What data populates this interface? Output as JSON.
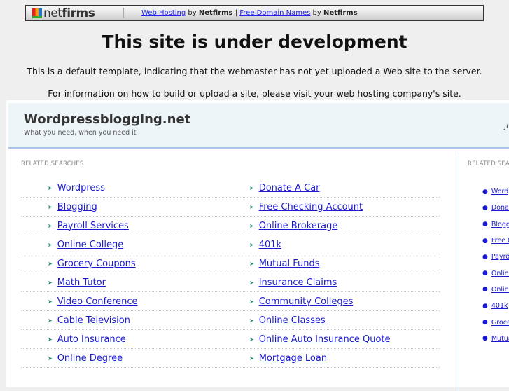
{
  "topbar": {
    "logo": "netfirms",
    "link1": "Web Hosting",
    "by1": "by",
    "brand1": "Netfirms",
    "sep": "|",
    "link2": "Free Domain Names",
    "by2": "by",
    "brand2": "Netfirms"
  },
  "title": "This site is under development",
  "message1": "This is a default template, indicating that the webmaster has not yet uploaded a Web site to the server.",
  "message2": "For information on how to build or upload a site, please visit your web hosting company's site.",
  "site": {
    "name": "Wordpressblogging.net",
    "tagline": "What you need, when you need it",
    "date_fragment": "Ju"
  },
  "related_label": "RELATED SEARCHES",
  "main_links": [
    [
      "Wordpress",
      "Donate A Car"
    ],
    [
      "Blogging",
      "Free Checking Account"
    ],
    [
      "Payroll Services",
      "Online Brokerage"
    ],
    [
      "Online College",
      "401k"
    ],
    [
      "Grocery Coupons",
      "Mutual Funds"
    ],
    [
      "Math Tutor",
      "Insurance Claims"
    ],
    [
      "Video Conference",
      "Community Colleges"
    ],
    [
      "Cable Television",
      "Online Classes"
    ],
    [
      "Auto Insurance",
      "Online Auto Insurance Quote"
    ],
    [
      "Online Degree",
      "Mortgage Loan"
    ]
  ],
  "side_links": [
    "Wordpress",
    "Donate A Car",
    "Blogging",
    "Free Checking Account",
    "Payroll Services",
    "Online College",
    "Online Brokerage",
    "401k",
    "Grocery Coupons",
    "Mutual Funds"
  ]
}
